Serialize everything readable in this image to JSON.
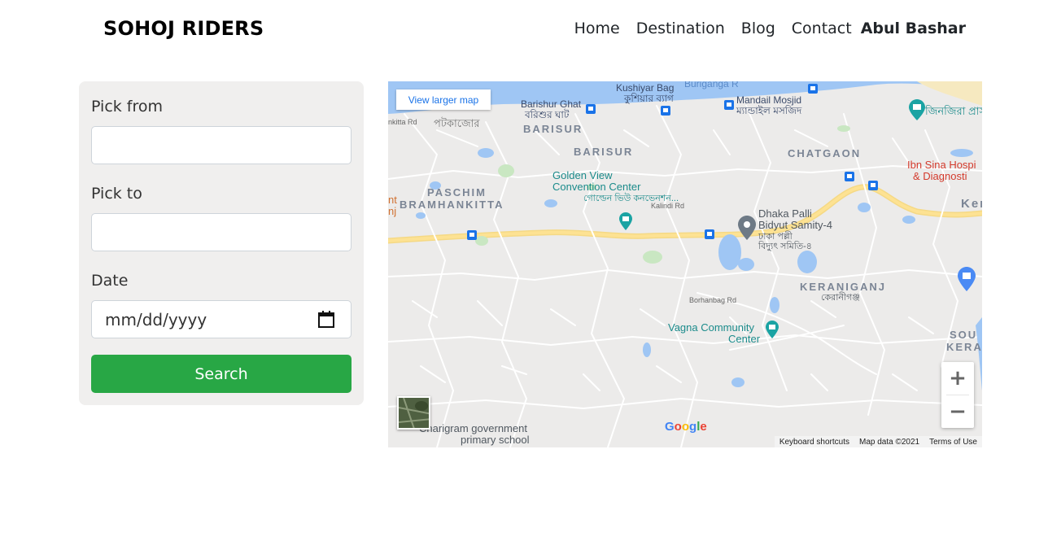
{
  "header": {
    "brand": "SOHOJ RIDERS",
    "nav": [
      "Home",
      "Destination",
      "Blog",
      "Contact"
    ],
    "user": "Abul Bashar"
  },
  "form": {
    "pick_from_label": "Pick from",
    "pick_from_value": "",
    "pick_to_label": "Pick to",
    "pick_to_value": "",
    "date_label": "Date",
    "date_placeholder": "mm/dd/yyyy",
    "search_label": "Search",
    "search_color": "#28a745"
  },
  "map": {
    "larger_map": "View larger map",
    "areas": [
      "BARISUR",
      "BARISUR",
      "CHATGAON",
      "PASCHIM",
      "BRAMHANKITTA",
      "KERANIGANJ",
      "SOU",
      "KERANI"
    ],
    "places": {
      "kushiyar": "Kushiyar Bag",
      "kushiyar_bn": "কুশিয়ার ব্যাগ",
      "buriganga": "Buriganga R",
      "barishur_ghat": "Barishur Ghat",
      "barishur_ghat_bn": "বরিশুর ঘাট",
      "mandail": "Mandail Mosjid",
      "mandail_bn": "ম্যান্ডাইল মসজিদ",
      "jinjira_bn": "জিনজিরা প্রাসা",
      "kitta_rd": "nkitta Rd",
      "potkajor_bn": "পটকাজোর",
      "golden_1": "Golden View",
      "golden_2": "Convention Center",
      "golden_bn": "গোল্ডেন ভিউ কনভেনশন...",
      "ibn_1": "Ibn Sina Hospi",
      "ibn_2": "& Diagnosti",
      "ker": "Ker",
      "dhaka_1": "Dhaka Palli",
      "dhaka_2": "Bidyut Samity-4",
      "dhaka_bn1": "ঢাকা পল্লী",
      "dhaka_bn2": "বিদ্যুৎ সমিতি-৪",
      "keraniganj_bn": "কেরানীগঞ্জ",
      "borhan_rd": "Borhanbag Rd",
      "kalindi_rd": "Kalindi Rd",
      "vagna_1": "Vagna Community",
      "vagna_2": "Center",
      "charigram_1": "Charigram government",
      "charigram_2": "primary school",
      "left_nt": "nt",
      "left_nj": "nj"
    },
    "zoom_in": "+",
    "zoom_out": "−",
    "google": "Google",
    "attribution": [
      "Keyboard shortcuts",
      "Map data ©2021",
      "Terms of Use"
    ]
  }
}
